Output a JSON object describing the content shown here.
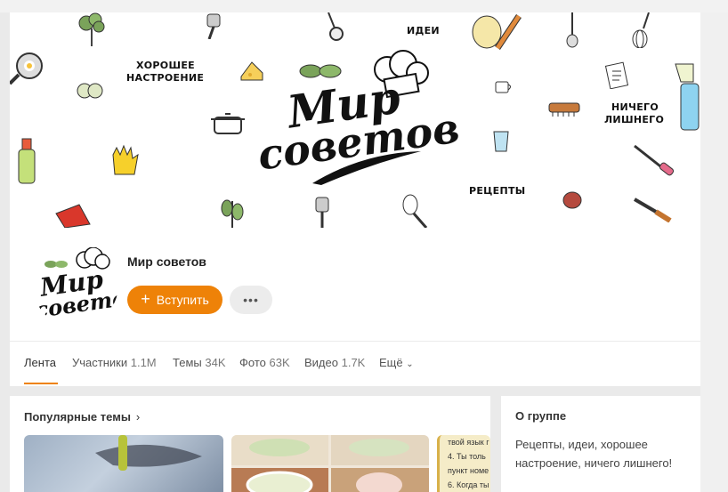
{
  "cover": {
    "words": [
      "ИДЕИ",
      "ХОРОШЕЕ",
      "НАСТРОЕНИЕ",
      "НИЧЕГО",
      "ЛИШНЕГО",
      "РЕЦЕПТЫ"
    ],
    "logo_line1": "Мир",
    "logo_line2": "советов"
  },
  "avatar": {
    "logo_line1": "Мир",
    "logo_line2": "советов"
  },
  "group": {
    "name": "Мир советов",
    "join_label": "Вступить",
    "more_label": "•••"
  },
  "tabs": [
    {
      "label": "Лента",
      "count": ""
    },
    {
      "label": "Участники",
      "count": "1.1M"
    },
    {
      "label": "Темы",
      "count": "34K"
    },
    {
      "label": "Фото",
      "count": "63K"
    },
    {
      "label": "Видео",
      "count": "1.7K"
    },
    {
      "label": "Ещё",
      "count": ""
    }
  ],
  "popular": {
    "title": "Популярные темы",
    "thumb_text": [
      "твой язык г",
      "4. Ты толь",
      "пункт номе",
      "6. Когда ты"
    ]
  },
  "about": {
    "title": "О группе",
    "text": "Рецепты, идеи, хорошее настроение, ничего лишнего!"
  },
  "colors": {
    "accent": "#ee8208",
    "background": "#eaeaea",
    "card": "#ffffff"
  }
}
